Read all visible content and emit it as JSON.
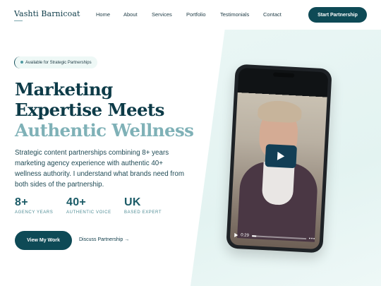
{
  "header": {
    "logo": "Vashti Barnicoat",
    "nav": [
      "Home",
      "About",
      "Services",
      "Portfolio",
      "Testimonials",
      "Contact"
    ],
    "cta": "Start Partnership"
  },
  "hero": {
    "badge": "Available for Strategic Partnerships",
    "headline_line1": "Marketing",
    "headline_line2": "Expertise Meets",
    "headline_line3": "Authentic Wellness",
    "description": "Strategic content partnerships combining 8+ years marketing agency experience with authentic 40+ wellness authority. I understand what brands need from both sides of the partnership.",
    "stats": [
      {
        "value": "8+",
        "label": "AGENCY YEARS"
      },
      {
        "value": "40+",
        "label": "AUTHENTIC VOICE"
      },
      {
        "value": "UK",
        "label": "BASED EXPERT"
      }
    ],
    "primary_button": "View My Work",
    "secondary_link": "Discuss Partnership →"
  },
  "video": {
    "time": "0:29"
  },
  "icons": {
    "play": "play-icon",
    "status_dot": "dot-icon",
    "more": "more-icon"
  },
  "colors": {
    "primary": "#0e4a56",
    "accent": "#7fb1b7",
    "panel": "#e3f3f1"
  }
}
